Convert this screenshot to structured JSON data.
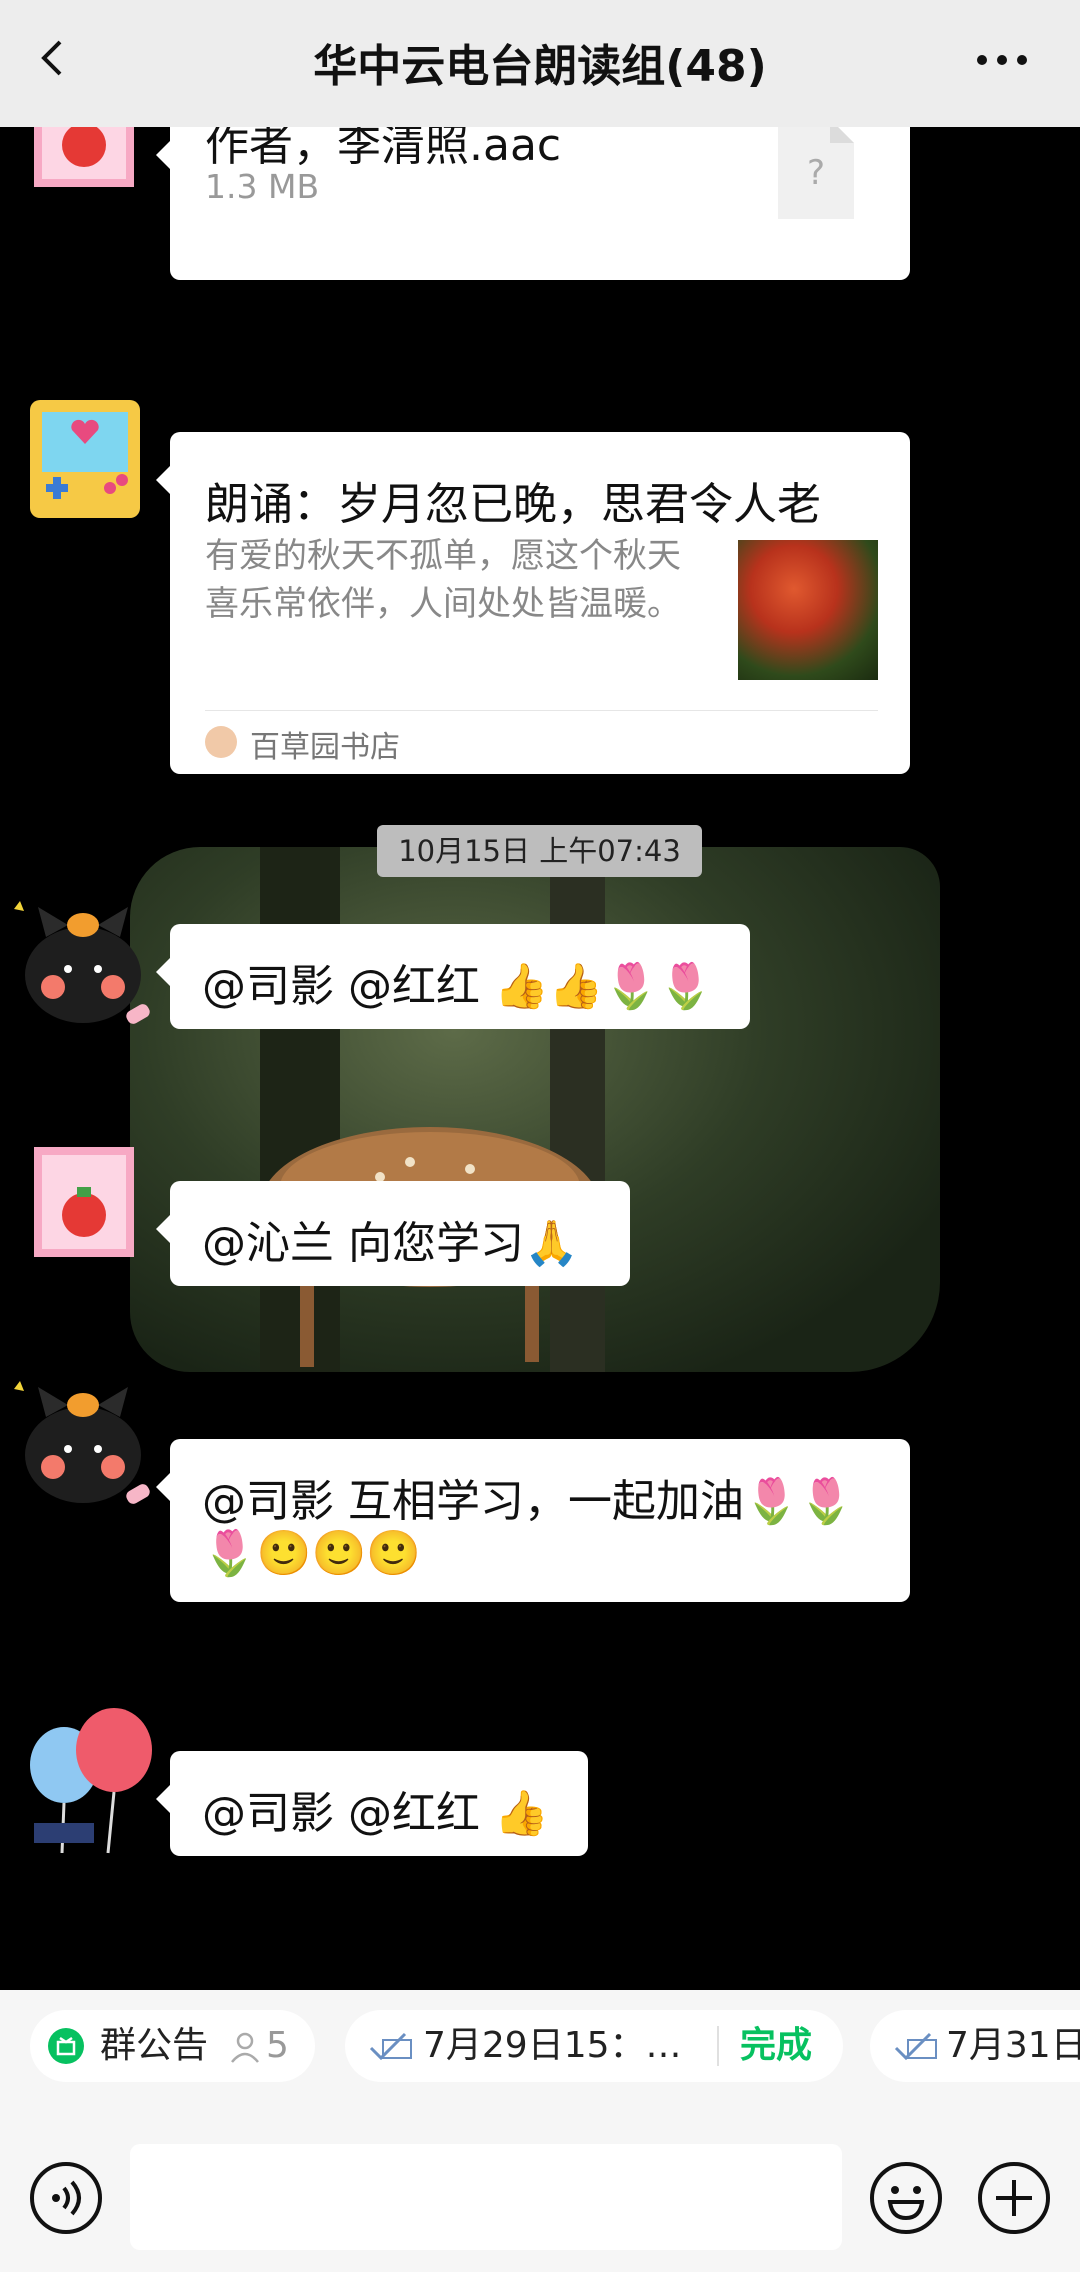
{
  "header": {
    "title": "华中云电台朗读组(48)"
  },
  "messages": {
    "file": {
      "name": "作者，李清照.aac",
      "size": "1.3 MB",
      "icon_label": "?"
    },
    "card": {
      "title": "朗诵：岁月忽已晚，思君令人老",
      "desc": "有爱的秋天不孤单，愿这个秋天喜乐常依伴，人间处处皆温暖。",
      "source": "百草园书店"
    },
    "timestamp": "10月15日 上午07:43",
    "m1": "@司影 @红红 👍👍🌷🌷",
    "m2": "@沁兰 向您学习🙏",
    "m3_line1": "@司影 互相学习，一起加油🌷🌷",
    "m3_line2": "🌷🙂🙂🙂",
    "m4": "@司影 @红红 👍"
  },
  "quickbar": {
    "announcement_label": "群公告",
    "announcement_count": "5",
    "vote1_label": "7月29日15：…",
    "vote1_status": "完成",
    "vote2_label": "7月31日"
  },
  "colors": {
    "accent_green": "#07c160",
    "header_bg": "#ededed",
    "chat_bg": "#000000"
  }
}
